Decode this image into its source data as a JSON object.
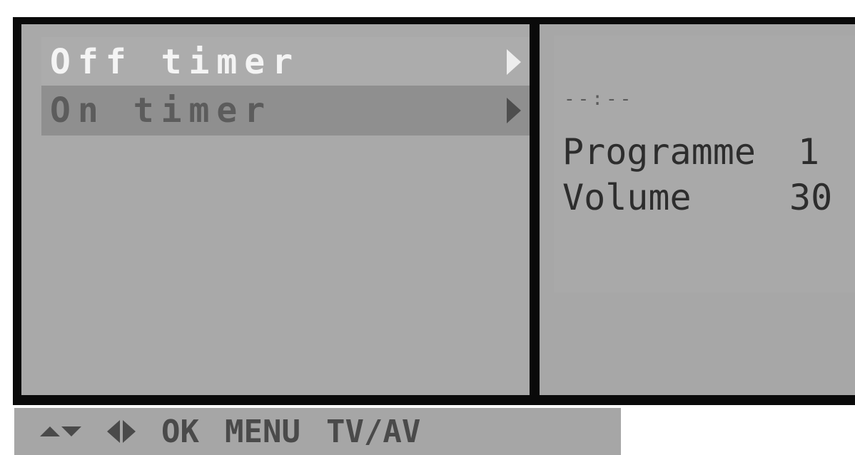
{
  "menu": {
    "items": [
      {
        "label": "Off timer",
        "icon": "chevron-right-icon"
      },
      {
        "label": "On timer",
        "icon": "chevron-right-icon"
      }
    ]
  },
  "info_panel": {
    "time": "--:--",
    "programme_label": "Programme",
    "programme_value": "1",
    "volume_label": "Volume",
    "volume_value": "30"
  },
  "help_bar": {
    "updown_icon": "up-down-arrows-icon",
    "leftright_icon": "left-right-arrows-icon",
    "ok_label": "OK",
    "menu_label": "MENU",
    "tvav_label": "TV/AV"
  }
}
